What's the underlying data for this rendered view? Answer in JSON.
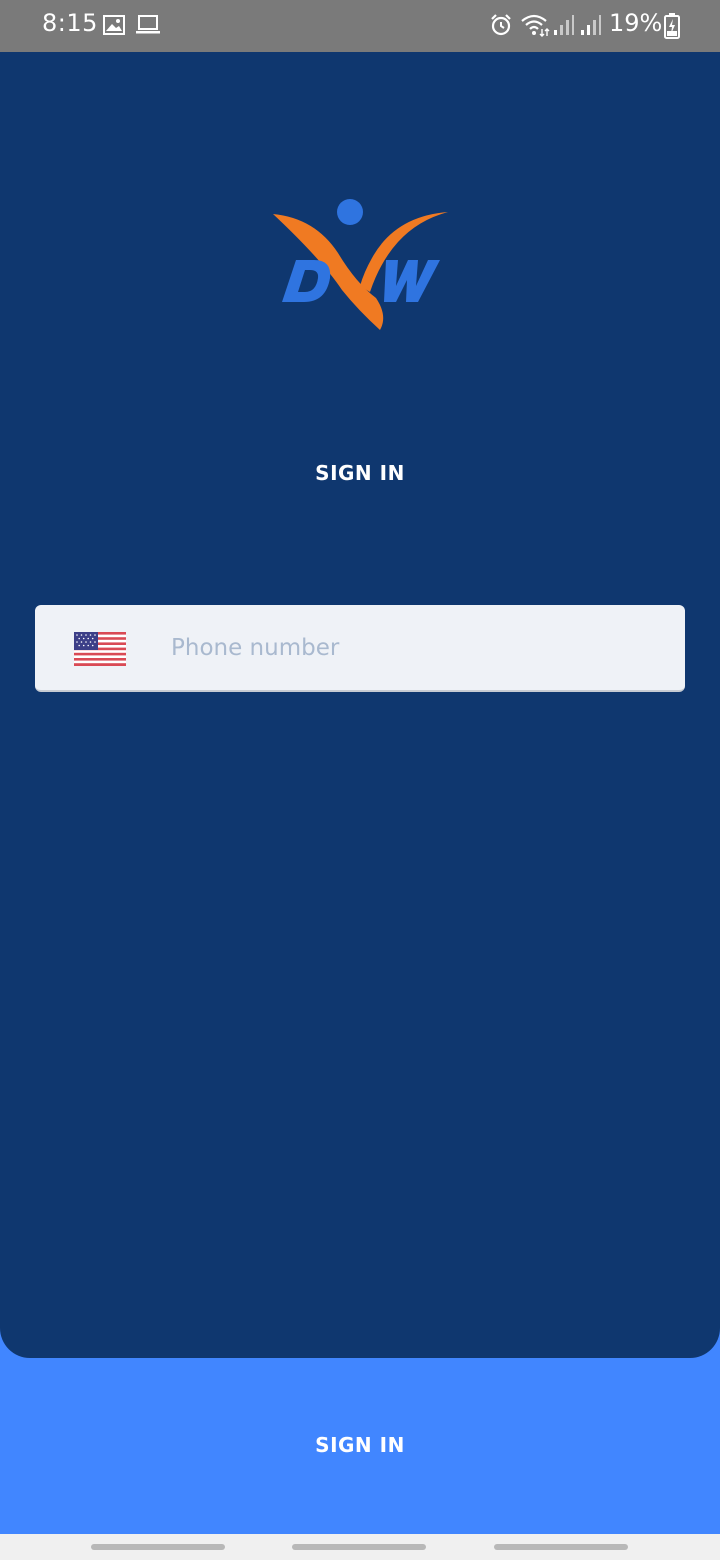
{
  "status_bar": {
    "time": "8:15",
    "battery_percent": "19%",
    "icons": [
      "gallery-icon",
      "laptop-icon",
      "alarm-icon",
      "wifi-icon",
      "signal-icon",
      "signal-icon-2",
      "battery-charging-icon"
    ]
  },
  "logo": {
    "name": "dyw-logo",
    "letters": "DYW",
    "colors": {
      "blue": "#2f74e0",
      "orange": "#f07a22"
    }
  },
  "title": "SIGN IN",
  "phone": {
    "country_flag": "us-flag-icon",
    "placeholder": "Phone number",
    "value": ""
  },
  "bottom_button": {
    "label": "SIGN IN"
  },
  "colors": {
    "panel": "#0f376f",
    "accent": "#4186ff",
    "status_bar": "#7a7a7a"
  }
}
